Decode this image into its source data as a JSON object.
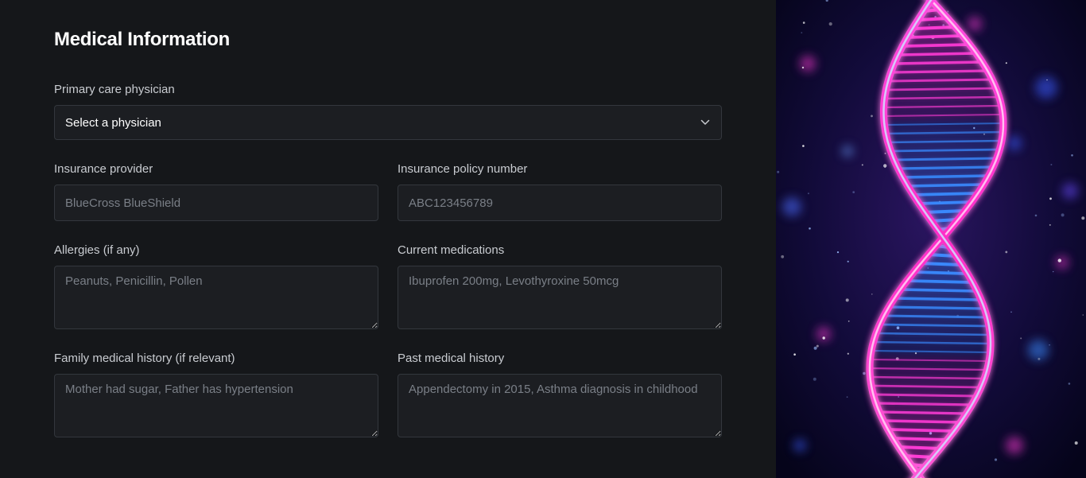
{
  "form": {
    "title": "Medical Information",
    "physician": {
      "label": "Primary care physician",
      "selected": "Select a physician"
    },
    "insurance_provider": {
      "label": "Insurance provider",
      "placeholder": "BlueCross BlueShield"
    },
    "policy_number": {
      "label": "Insurance policy number",
      "placeholder": "ABC123456789"
    },
    "allergies": {
      "label": "Allergies (if any)",
      "placeholder": "Peanuts, Penicillin, Pollen"
    },
    "medications": {
      "label": "Current medications",
      "placeholder": "Ibuprofen 200mg, Levothyroxine 50mcg"
    },
    "family_history": {
      "label": "Family medical history (if relevant)",
      "placeholder": "Mother had sugar, Father has hypertension"
    },
    "past_history": {
      "label": "Past medical history",
      "placeholder": "Appendectomy in 2015, Asthma diagnosis in childhood"
    }
  },
  "theme": {
    "background": "#15171a",
    "input_background": "#1c1e22",
    "input_border": "#33373d",
    "helix_pink": "#ff3bd6",
    "helix_blue": "#3a8bff"
  },
  "icons": {
    "select_arrow": "chevron-down-icon",
    "hero_image": "dna-helix-image"
  }
}
